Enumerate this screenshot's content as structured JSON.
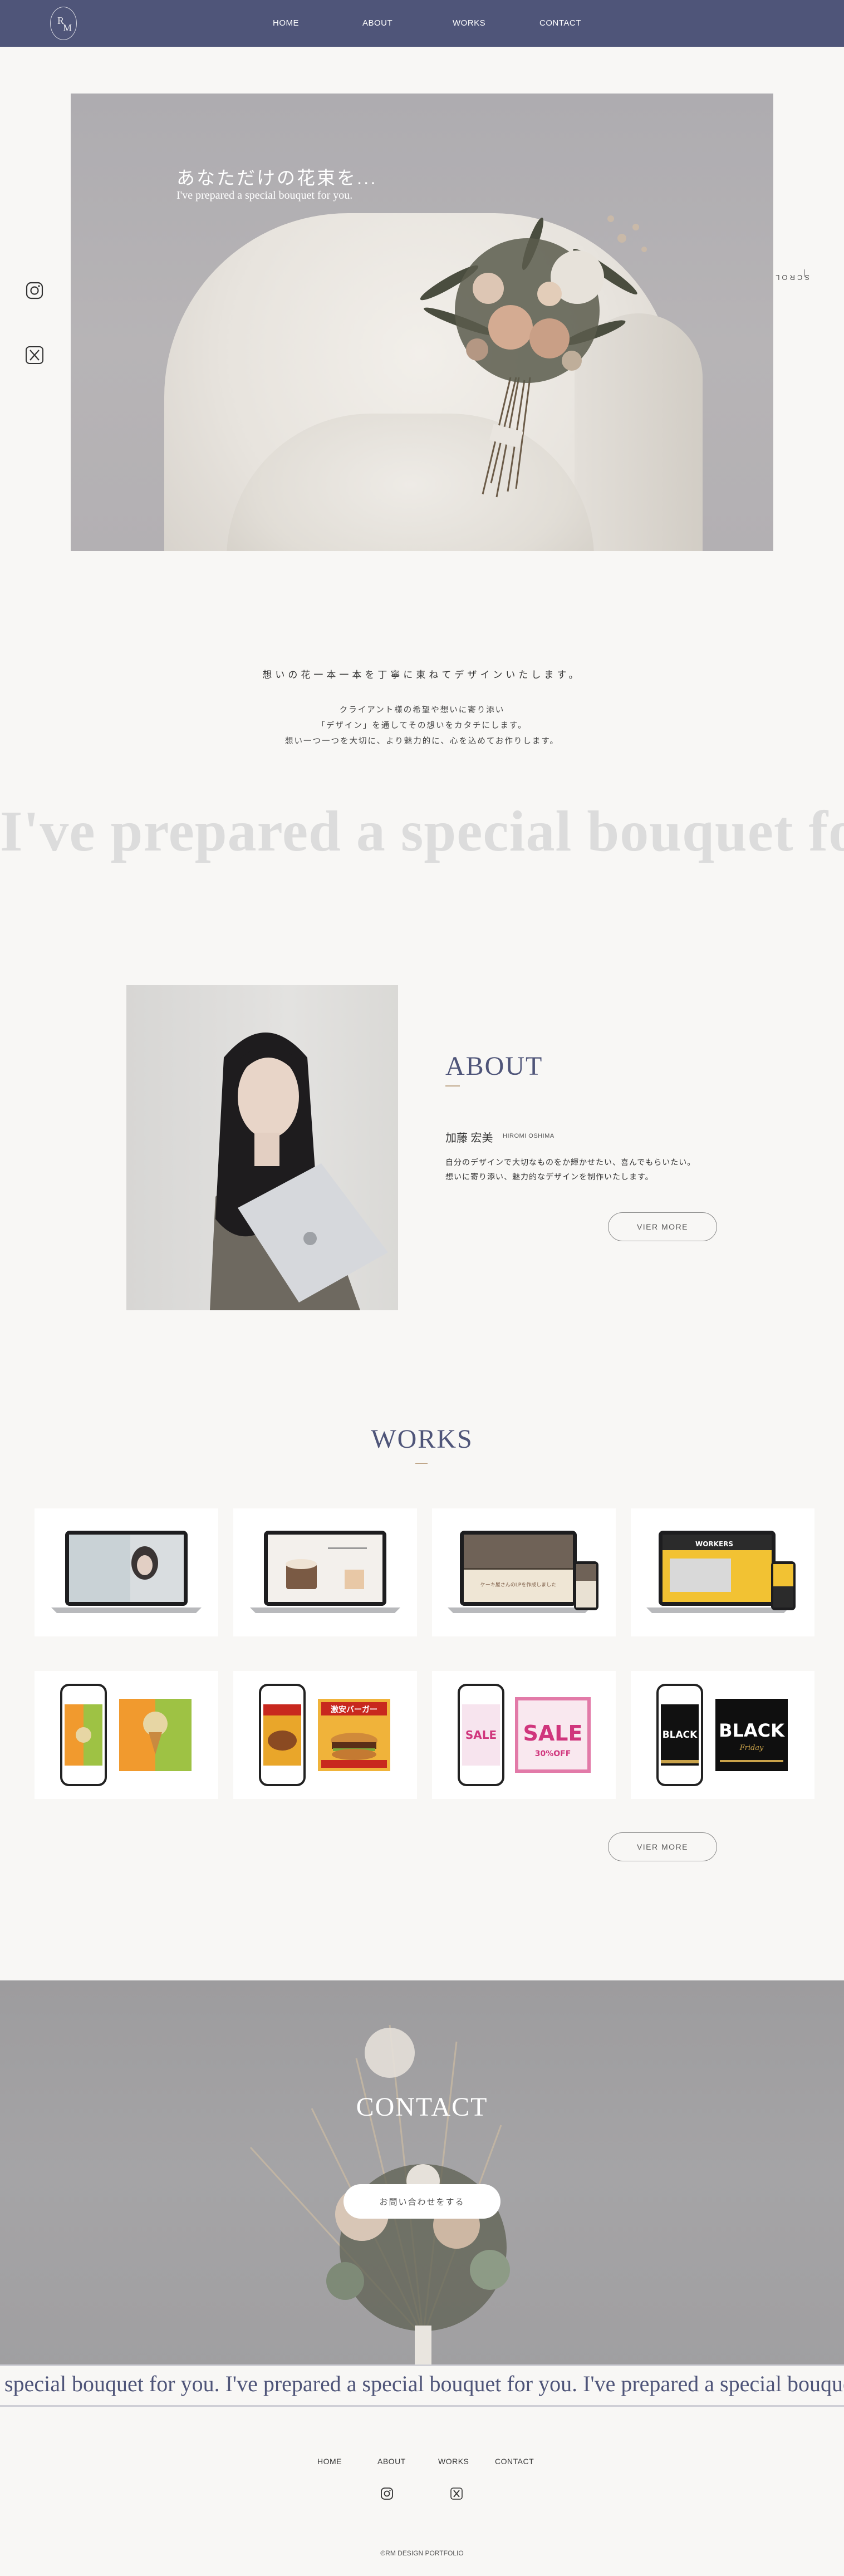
{
  "header": {
    "logo_initials": [
      "R",
      "M"
    ],
    "nav": [
      "HOME",
      "ABOUT",
      "WORKS",
      "CONTACT"
    ]
  },
  "hero": {
    "title": "あなただけの花束を...",
    "subtitle": "I've prepared a special bouquet for you.",
    "scroll_label": "SCROLL"
  },
  "social": {
    "icons": [
      "instagram-icon",
      "x-twitter-icon"
    ]
  },
  "intro": {
    "title": "想いの花一本一本を丁寧に束ねてデザインいたします。",
    "lines": [
      "クライアント様の希望や想いに寄り添い",
      "「デザイン」を通してその想いをカタチにします。",
      "想い一つ一つを大切に、より魅力的に、心を込めてお作りします。"
    ]
  },
  "big_text": "I've prepared a special bouquet for you",
  "about": {
    "heading": "ABOUT",
    "name": "加藤 宏美",
    "name_roman": "HIROMI OSHIMA",
    "lines": [
      "自分のデザインで大切なものをか輝かせたい、喜んでもらいたい。",
      "想いに寄り添い、魅力的なデザインを制作いたします。"
    ],
    "button": "VIER MORE"
  },
  "works": {
    "heading": "WORKS",
    "button": "VIER MORE",
    "banner_texts": {
      "lp_copy": "ケーキ屋さんのLPを作成しました",
      "burger": "激安バーガー",
      "sale": "SALE",
      "sale_sub": "30%OFF",
      "black": "BLACK",
      "black_sub": "Friday"
    }
  },
  "contact": {
    "heading": "CONTACT",
    "button": "お問い合わせをする"
  },
  "marquee": "special bouquet for you.   I've prepared a special bouquet for you.   I've prepared a special bouquet for you.",
  "footer": {
    "nav": [
      "HOME",
      "ABOUT",
      "WORKS",
      "CONTACT"
    ],
    "copyright": "©RM DESIGN PORTFOLIO"
  },
  "colors": {
    "navy": "#4f5579",
    "accent": "#c0a78a",
    "background": "#f8f7f5"
  }
}
